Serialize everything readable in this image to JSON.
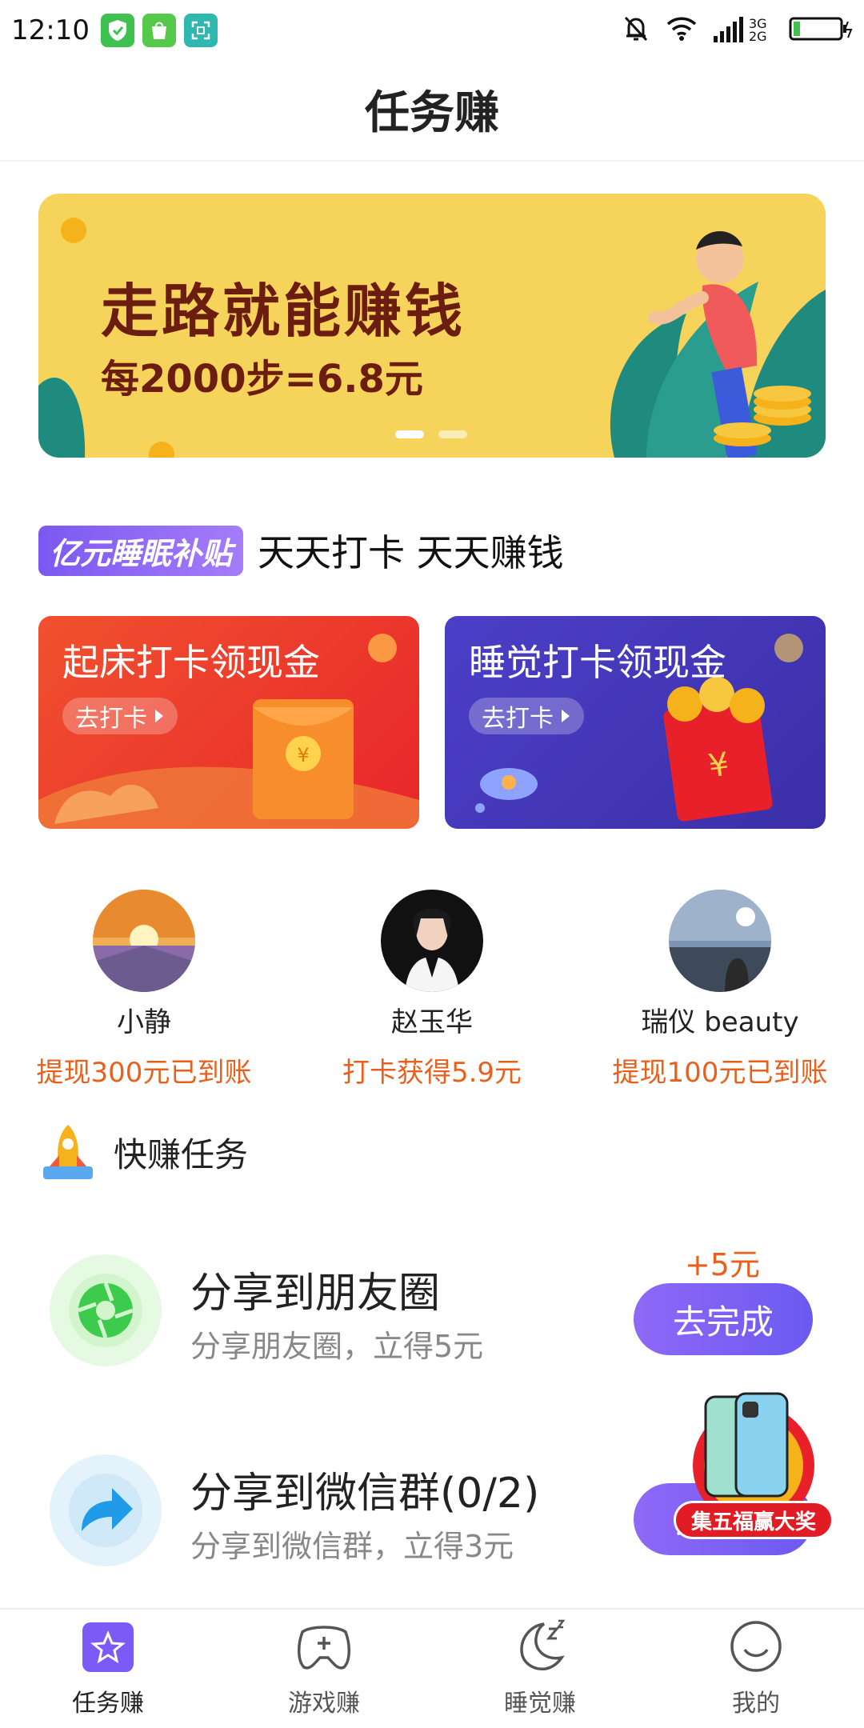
{
  "status_bar": {
    "time": "12:10",
    "network": "3G 2G"
  },
  "header": {
    "title": "任务赚"
  },
  "banner": {
    "headline": "走路就能赚钱",
    "subline": "每2000步=6.8元"
  },
  "subsidy": {
    "badge": "亿元睡眠补贴",
    "slogan": "天天打卡 天天赚钱"
  },
  "checkin_cards": [
    {
      "title": "起床打卡领现金",
      "button": "去打卡"
    },
    {
      "title": "睡觉打卡领现金",
      "button": "去打卡"
    }
  ],
  "users": [
    {
      "name": "小静",
      "info": "提现300元已到账"
    },
    {
      "name": "赵玉华",
      "info": "打卡获得5.9元"
    },
    {
      "name": "瑞仪 beauty",
      "info": "提现100元已到账"
    }
  ],
  "quick_tasks": {
    "title": "快赚任务",
    "items": [
      {
        "title": "分享到朋友圈",
        "subtitle": "分享朋友圈，立得5元",
        "reward": "+5元",
        "button": "去完成"
      },
      {
        "title": "分享到微信群(0/2)",
        "subtitle": "分享到微信群，立得3元",
        "reward": "",
        "button": "去完成"
      }
    ]
  },
  "promo": {
    "label": "集五福赢大奖"
  },
  "tabbar": [
    {
      "label": "任务赚",
      "icon": "star-icon"
    },
    {
      "label": "游戏赚",
      "icon": "gamepad-icon"
    },
    {
      "label": "睡觉赚",
      "icon": "moon-icon"
    },
    {
      "label": "我的",
      "icon": "smiley-icon"
    }
  ],
  "colors": {
    "accent": "#7a5af5",
    "orange": "#e8611c",
    "banner": "#f6d35a",
    "card_morning": "#ef4a2e",
    "card_night": "#4a3bbf"
  }
}
